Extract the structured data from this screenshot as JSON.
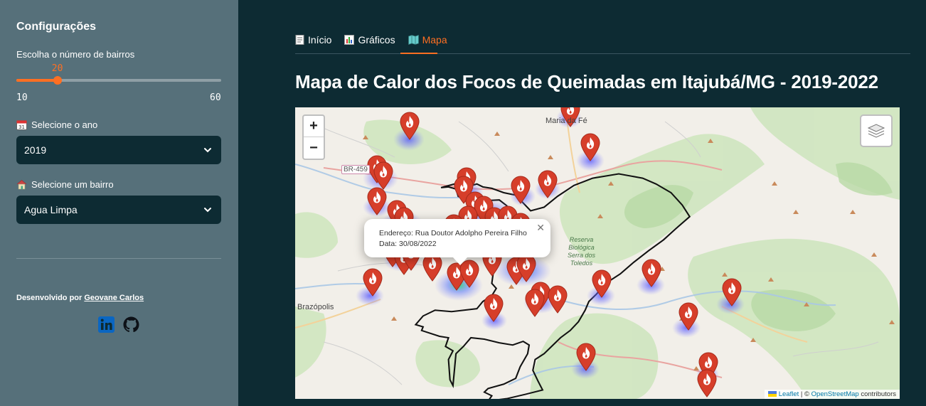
{
  "sidebar": {
    "title": "Configurações",
    "slider": {
      "label": "Escolha o número de bairros",
      "value": "20",
      "min": "10",
      "max": "60",
      "fraction": 0.2
    },
    "year": {
      "label": "Selecione o ano",
      "value": "2019"
    },
    "neighborhood": {
      "label": "Selecione um bairro",
      "value": "Agua Limpa"
    },
    "footer": {
      "prefix": "Desenvolvido por",
      "author": "Geovane Carlos"
    }
  },
  "tabs": [
    {
      "label": "Início"
    },
    {
      "label": "Gráficos"
    },
    {
      "label": "Mapa"
    }
  ],
  "page_title": "Mapa de Calor dos Focos de Queimadas em Itajubá/MG - 2019-2022",
  "map": {
    "labels": {
      "town1": "Maria da Fé",
      "town2": "Brazópolis",
      "road": "BR-459"
    },
    "reserve": {
      "line1": "Reserva",
      "line2": "Biológica",
      "line3": "Serra dos",
      "line4": "Toledos"
    },
    "popup": {
      "address": "Endereço: Rua Doutor Adolpho Pereira Filho",
      "date": "Data: 30/08/2022"
    },
    "attribution": {
      "leaflet": "Leaflet",
      "sep": " | © ",
      "osm": "OpenStreetMap",
      "suffix": " contributors"
    },
    "zoom_in": "+",
    "zoom_out": "−"
  },
  "colors": {
    "accent": "#ff6f22",
    "sidebar": "#56707a",
    "main_bg": "#0d2b33",
    "marker": "#d63e2a"
  }
}
